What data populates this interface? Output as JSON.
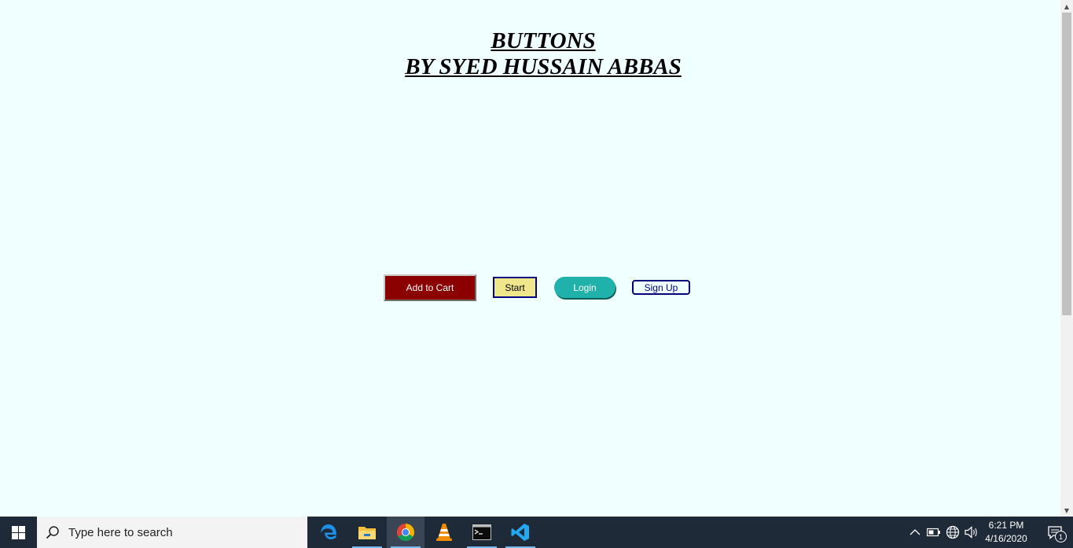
{
  "page": {
    "title_line_1": "BUTTONS",
    "title_line_2": "BY SYED HUSSAIN ABBAS",
    "background": "#f0ffff"
  },
  "buttons": {
    "add_to_cart": {
      "label": "Add to Cart",
      "bg": "#8b0000"
    },
    "start": {
      "label": "Start",
      "bg": "#f0e68c"
    },
    "login": {
      "label": "Login",
      "bg": "#20b2aa"
    },
    "sign_up": {
      "label": "Sign Up",
      "border": "#000080"
    }
  },
  "taskbar": {
    "search_placeholder": "Type here to search",
    "apps": [
      {
        "name": "Microsoft Edge",
        "icon": "edge-icon",
        "active": false
      },
      {
        "name": "File Explorer",
        "icon": "folder-icon",
        "active": false
      },
      {
        "name": "Google Chrome",
        "icon": "chrome-icon",
        "active": true
      },
      {
        "name": "VLC media player",
        "icon": "vlc-cone-icon",
        "active": false
      },
      {
        "name": "Command Prompt",
        "icon": "terminal-icon",
        "active": false
      },
      {
        "name": "Visual Studio Code",
        "icon": "vscode-icon",
        "active": false
      }
    ],
    "tray": {
      "icons": [
        "chevron-up-icon",
        "battery-icon",
        "globe-icon",
        "speaker-icon"
      ]
    },
    "clock": {
      "time": "6:21 PM",
      "date": "4/16/2020"
    },
    "notifications": {
      "count": "1"
    }
  }
}
